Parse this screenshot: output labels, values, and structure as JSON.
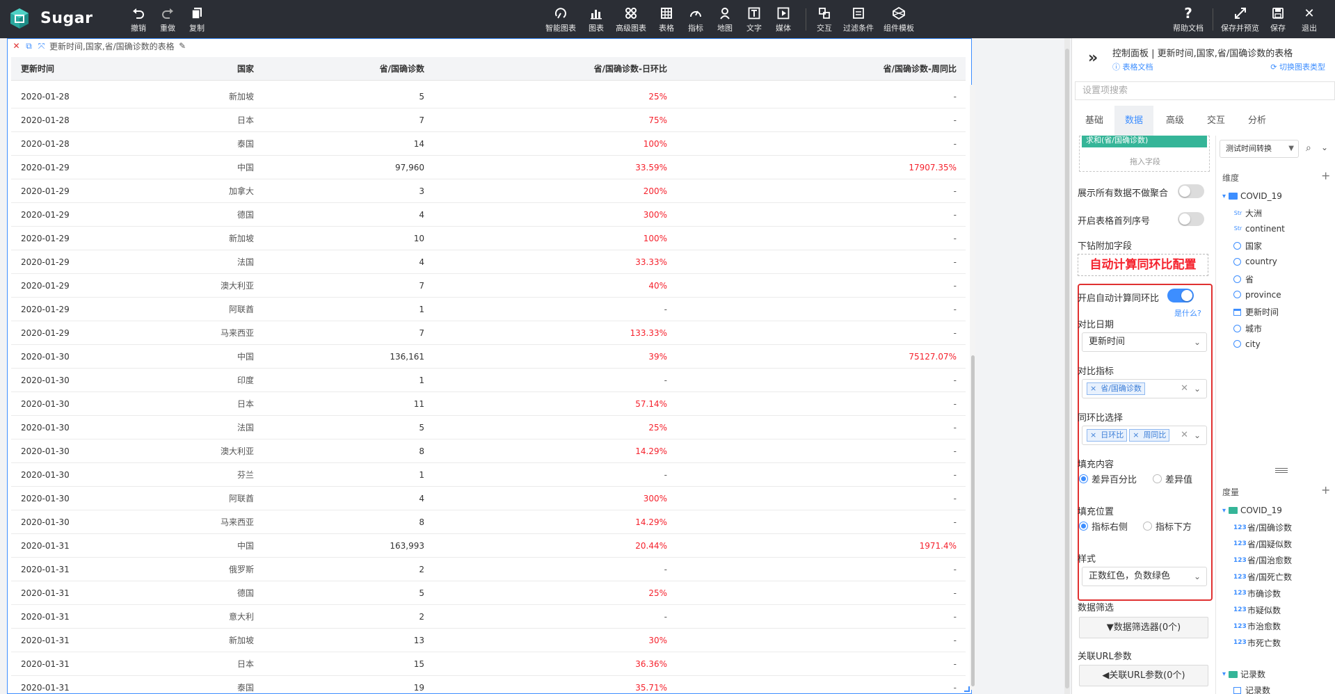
{
  "app": {
    "name": "Sugar"
  },
  "toolbar": {
    "undo": "撤销",
    "redo": "重做",
    "copy": "复制",
    "smart_chart": "智能图表",
    "chart": "图表",
    "advanced_chart": "高级图表",
    "table": "表格",
    "indicator": "指标",
    "map": "地图",
    "text": "文字",
    "media": "媒体",
    "interact": "交互",
    "filter": "过滤条件",
    "component_template": "组件模板",
    "help": "帮助文档",
    "save_preview": "保存并预览",
    "save": "保存",
    "exit": "退出"
  },
  "widget": {
    "title": "更新时间,国家,省/国确诊数的表格",
    "columns": [
      "更新时间",
      "国家",
      "省/国确诊数",
      "省/国确诊数-日环比",
      "省/国确诊数-周同比"
    ],
    "rows": [
      [
        "2020-01-28",
        "新加坡",
        "5",
        "25%",
        "-"
      ],
      [
        "2020-01-28",
        "日本",
        "7",
        "75%",
        "-"
      ],
      [
        "2020-01-28",
        "泰国",
        "14",
        "100%",
        "-"
      ],
      [
        "2020-01-29",
        "中国",
        "97,960",
        "33.59%",
        "17907.35%"
      ],
      [
        "2020-01-29",
        "加拿大",
        "3",
        "200%",
        "-"
      ],
      [
        "2020-01-29",
        "德国",
        "4",
        "300%",
        "-"
      ],
      [
        "2020-01-29",
        "新加坡",
        "10",
        "100%",
        "-"
      ],
      [
        "2020-01-29",
        "法国",
        "4",
        "33.33%",
        "-"
      ],
      [
        "2020-01-29",
        "澳大利亚",
        "7",
        "40%",
        "-"
      ],
      [
        "2020-01-29",
        "阿联酋",
        "1",
        "-",
        "-"
      ],
      [
        "2020-01-29",
        "马来西亚",
        "7",
        "133.33%",
        "-"
      ],
      [
        "2020-01-30",
        "中国",
        "136,161",
        "39%",
        "75127.07%"
      ],
      [
        "2020-01-30",
        "印度",
        "1",
        "-",
        "-"
      ],
      [
        "2020-01-30",
        "日本",
        "11",
        "57.14%",
        "-"
      ],
      [
        "2020-01-30",
        "法国",
        "5",
        "25%",
        "-"
      ],
      [
        "2020-01-30",
        "澳大利亚",
        "8",
        "14.29%",
        "-"
      ],
      [
        "2020-01-30",
        "芬兰",
        "1",
        "-",
        "-"
      ],
      [
        "2020-01-30",
        "阿联酋",
        "4",
        "300%",
        "-"
      ],
      [
        "2020-01-30",
        "马来西亚",
        "8",
        "14.29%",
        "-"
      ],
      [
        "2020-01-31",
        "中国",
        "163,993",
        "20.44%",
        "1971.4%"
      ],
      [
        "2020-01-31",
        "俄罗斯",
        "2",
        "-",
        "-"
      ],
      [
        "2020-01-31",
        "德国",
        "5",
        "25%",
        "-"
      ],
      [
        "2020-01-31",
        "意大利",
        "2",
        "-",
        "-"
      ],
      [
        "2020-01-31",
        "新加坡",
        "13",
        "30%",
        "-"
      ],
      [
        "2020-01-31",
        "日本",
        "15",
        "36.36%",
        "-"
      ],
      [
        "2020-01-31",
        "泰国",
        "19",
        "35.71%",
        "-"
      ]
    ]
  },
  "panel": {
    "title": "控制面板 | 更新时间,国家,省/国确诊数的表格",
    "doc_link": "表格文档",
    "switch_chart": "切换图表类型",
    "search_placeholder": "设置项搜索",
    "tabs": [
      "基础",
      "数据",
      "高级",
      "交互",
      "分析"
    ],
    "active_tab": "数据",
    "field_chip": "求和(省/国确诊数)",
    "drop_hint": "拖入字段",
    "show_all_label": "展示所有数据不做聚合",
    "serial_label": "开启表格首列序号",
    "drill_label": "下钻附加字段",
    "caption": "自动计算同环比配置",
    "auto_calc_label": "开启自动计算同环比",
    "what_link": "是什么?",
    "compare_date_label": "对比日期",
    "compare_date_value": "更新时间",
    "compare_metric_label": "对比指标",
    "compare_metric_chip": "省/国确诊数",
    "yoy_label": "同环比选择",
    "yoy_chips": [
      "日环比",
      "周同比"
    ],
    "fill_content_label": "填充内容",
    "fill_content_options": [
      "差异百分比",
      "差异值"
    ],
    "fill_pos_label": "填充位置",
    "fill_pos_options": [
      "指标右侧",
      "指标下方"
    ],
    "style_label": "样式",
    "style_value": "正数红色，负数绿色",
    "data_filter_label": "数据筛选",
    "data_filter_btn": "数据筛选器(0个)",
    "url_param_label": "关联URL参数",
    "url_param_btn": "关联URL参数(0个)"
  },
  "fields": {
    "dataset_select": "测试时间转换",
    "dimension_title": "维度",
    "measure_title": "度量",
    "folder": "COVID_19",
    "dimensions": [
      {
        "icon": "Str",
        "name": "大洲"
      },
      {
        "icon": "Str",
        "name": "continent"
      },
      {
        "icon": "globe",
        "name": "国家"
      },
      {
        "icon": "globe",
        "name": "country"
      },
      {
        "icon": "globe",
        "name": "省"
      },
      {
        "icon": "globe",
        "name": "province"
      },
      {
        "icon": "calendar",
        "name": "更新时间"
      },
      {
        "icon": "globe",
        "name": "城市"
      },
      {
        "icon": "globe",
        "name": "city"
      }
    ],
    "measures": [
      "省/国确诊数",
      "省/国疑似数",
      "省/国治愈数",
      "省/国死亡数",
      "市确诊数",
      "市疑似数",
      "市治愈数",
      "市死亡数"
    ],
    "record_folder": "记录数",
    "record_item": "记录数",
    "num_icon": "123"
  },
  "colors": {
    "accent": "#3d8eff",
    "positive": "#f5222d",
    "topbar": "#2b2e35",
    "field_green": "#35b598"
  }
}
